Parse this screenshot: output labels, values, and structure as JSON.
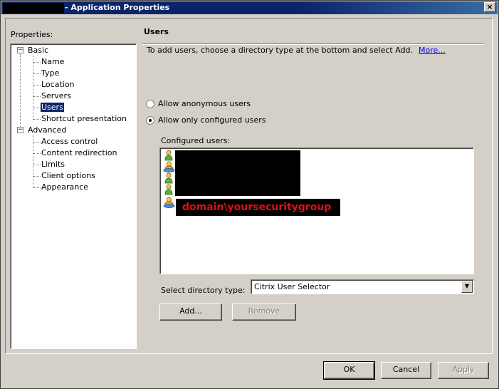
{
  "window": {
    "title": "- Application Properties",
    "close_label": "×"
  },
  "properties_label": "Properties:",
  "tree": {
    "groups": [
      {
        "label": "Basic",
        "expander": "−",
        "items": [
          {
            "label": "Name"
          },
          {
            "label": "Type"
          },
          {
            "label": "Location"
          },
          {
            "label": "Servers"
          },
          {
            "label": "Users",
            "selected": true
          },
          {
            "label": "Shortcut presentation"
          }
        ]
      },
      {
        "label": "Advanced",
        "expander": "−",
        "items": [
          {
            "label": "Access control"
          },
          {
            "label": "Content redirection"
          },
          {
            "label": "Limits"
          },
          {
            "label": "Client options"
          },
          {
            "label": "Appearance"
          }
        ]
      }
    ]
  },
  "main": {
    "section_title": "Users",
    "instructions": "To add users, choose a directory type at the bottom and select Add.",
    "more_link": "More...",
    "radio_anonymous": "Allow anonymous users",
    "radio_configured": "Allow only configured users",
    "selected_radio": "configured",
    "configured_users_label": "Configured users:",
    "users": [
      {
        "icon": "user-icon"
      },
      {
        "icon": "group-icon"
      },
      {
        "icon": "user-icon"
      },
      {
        "icon": "user-icon"
      },
      {
        "icon": "group-icon",
        "name": "domain\\yoursecuritygroup"
      }
    ],
    "directory_type_label": "Select directory type:",
    "directory_type_value": "Citrix User Selector",
    "add_button": "Add...",
    "remove_button": "Remove"
  },
  "footer": {
    "ok": "OK",
    "cancel": "Cancel",
    "apply": "Apply"
  },
  "colors": {
    "title_bar": "#0a246a",
    "selection": "#0a246a",
    "link": "#0000ff",
    "group_name_text": "#e01010"
  }
}
